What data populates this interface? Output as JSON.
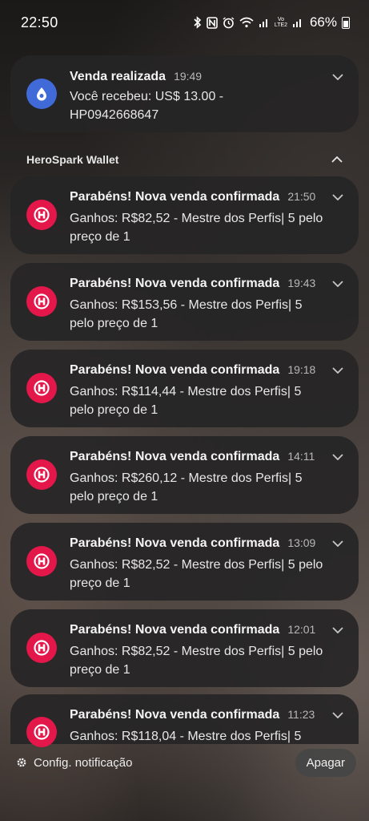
{
  "status_bar": {
    "time": "22:50",
    "icons": [
      "bluetooth-icon",
      "nfc-icon",
      "alarm-icon",
      "wifi-icon",
      "signal-icon",
      "volte-signal-icon"
    ],
    "lte_text": "Vo LTE2",
    "battery_percent": "66%"
  },
  "top_notification": {
    "title": "Venda realizada",
    "time": "19:49",
    "body": "Você recebeu: US$ 13.00 - HP0942668647",
    "icon_color": "#3f6ad8"
  },
  "group": {
    "app_name": "HeroSpark Wallet",
    "icon_color": "#e4174a",
    "notifications": [
      {
        "title": "Parabéns! Nova venda confirmada",
        "time": "21:50",
        "body": "Ganhos: R$82,52 - Mestre dos Perfis| 5 pelo preço de 1"
      },
      {
        "title": "Parabéns! Nova venda confirmada",
        "time": "19:43",
        "body": "Ganhos: R$153,56 - Mestre dos Perfis| 5 pelo preço de 1"
      },
      {
        "title": "Parabéns! Nova venda confirmada",
        "time": "19:18",
        "body": "Ganhos: R$114,44 - Mestre dos Perfis| 5 pelo preço de 1"
      },
      {
        "title": "Parabéns! Nova venda confirmada",
        "time": "14:11",
        "body": "Ganhos: R$260,12 - Mestre dos Perfis| 5 pelo preço de 1"
      },
      {
        "title": "Parabéns! Nova venda confirmada",
        "time": "13:09",
        "body": "Ganhos: R$82,52 - Mestre dos Perfis| 5 pelo preço de 1"
      },
      {
        "title": "Parabéns! Nova venda confirmada",
        "time": "12:01",
        "body": "Ganhos: R$82,52 - Mestre dos Perfis| 5 pelo preço de 1"
      },
      {
        "title": "Parabéns! Nova venda confirmada",
        "time": "11:23",
        "body": "Ganhos: R$118,04 - Mestre dos Perfis| 5"
      }
    ]
  },
  "footer": {
    "settings_label": "Config. notificação",
    "clear_label": "Apagar"
  }
}
